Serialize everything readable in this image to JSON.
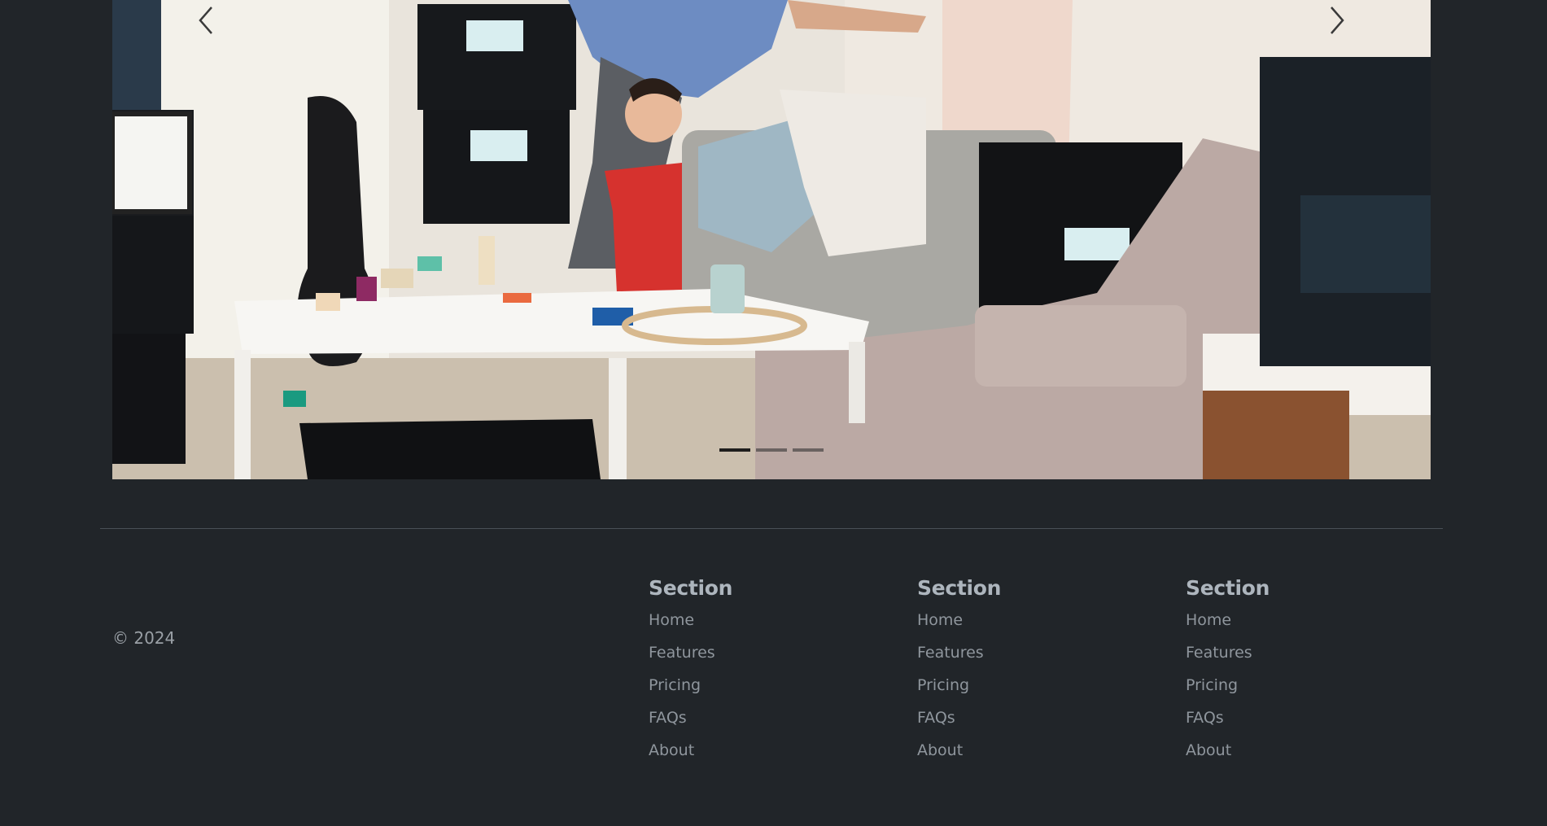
{
  "carousel": {
    "prev_label": "Previous",
    "next_label": "Next",
    "slide_count": 3,
    "active_slide": 1,
    "photo_subject": "family moving into home with HIVE BOXX storage bins"
  },
  "footer": {
    "copyright": "© 2024",
    "columns": [
      {
        "heading": "Section",
        "links": [
          "Home",
          "Features",
          "Pricing",
          "FAQs",
          "About"
        ]
      },
      {
        "heading": "Section",
        "links": [
          "Home",
          "Features",
          "Pricing",
          "FAQs",
          "About"
        ]
      },
      {
        "heading": "Section",
        "links": [
          "Home",
          "Features",
          "Pricing",
          "FAQs",
          "About"
        ]
      }
    ]
  },
  "colors": {
    "background": "#212529",
    "text_muted": "#8f969d",
    "heading": "#adb5bd",
    "divider": "#495057"
  }
}
